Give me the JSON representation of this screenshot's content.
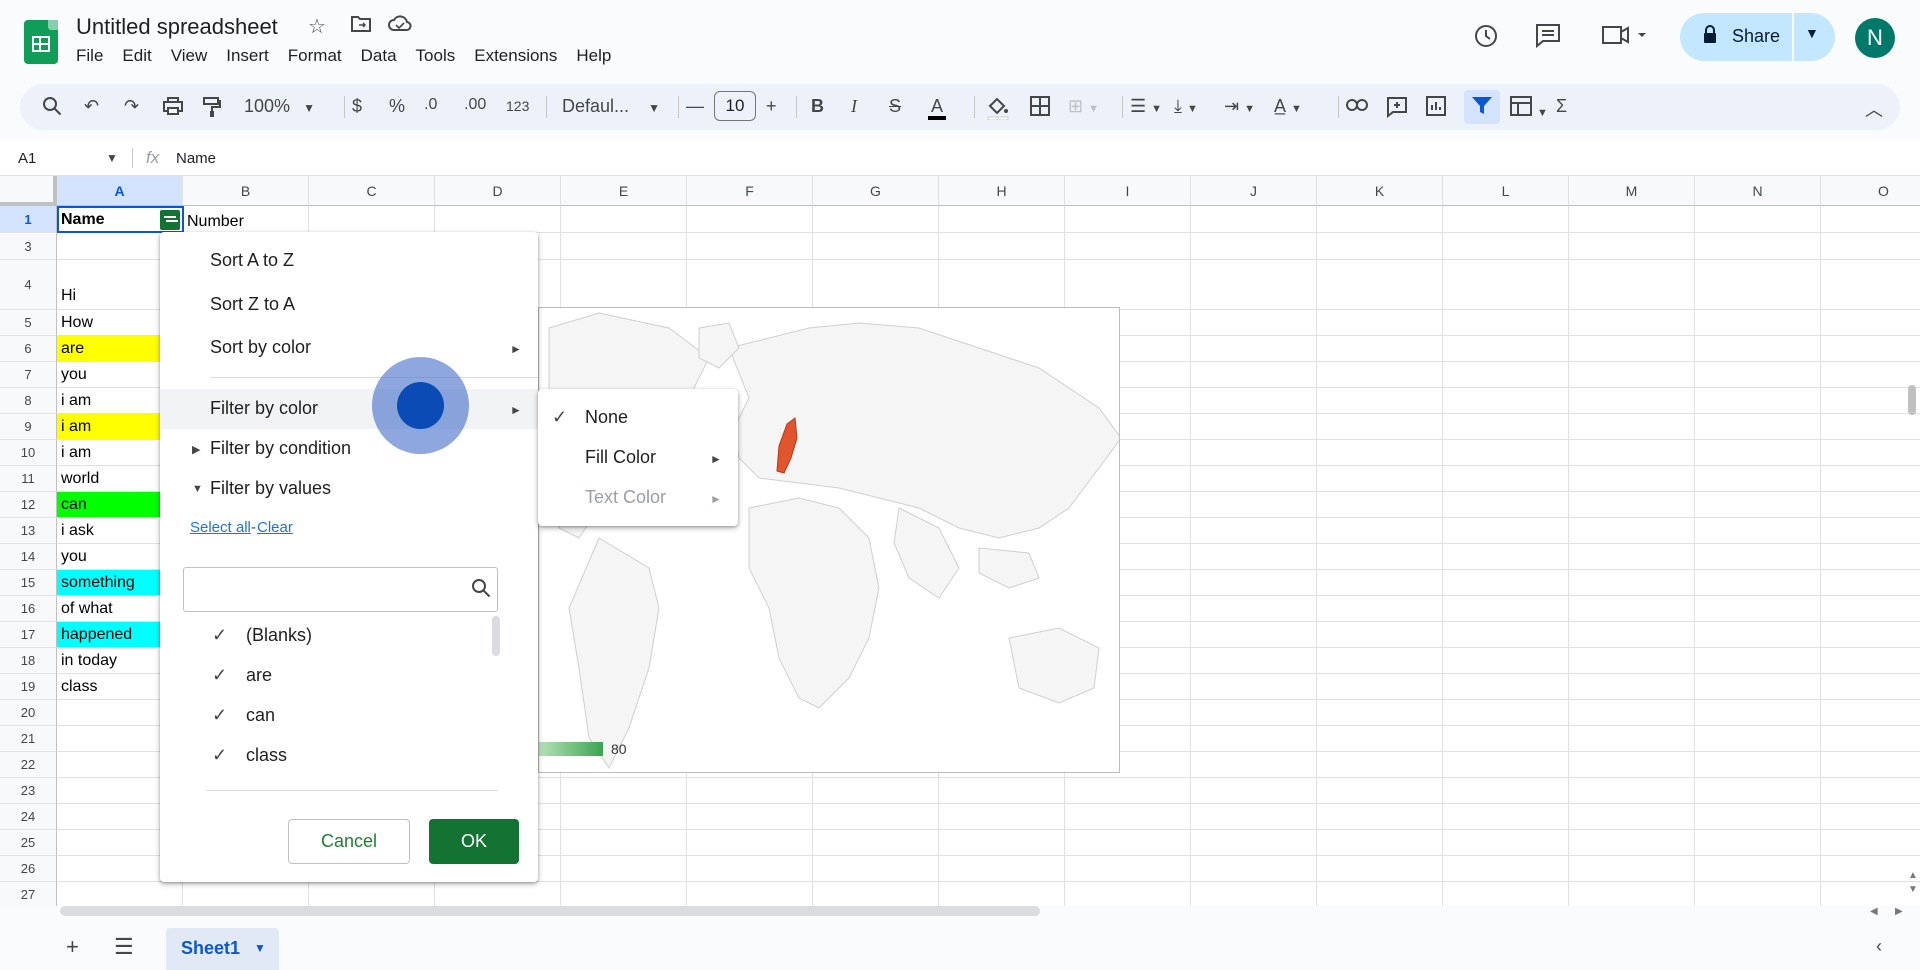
{
  "header": {
    "doc_title": "Untitled spreadsheet",
    "menu": [
      "File",
      "Edit",
      "View",
      "Insert",
      "Format",
      "Data",
      "Tools",
      "Extensions",
      "Help"
    ],
    "share_label": "Share",
    "avatar_initial": "N"
  },
  "toolbar": {
    "zoom": "100%",
    "currency": "$",
    "percent": "%",
    "dec_decrease": ".0",
    "dec_increase": ".00",
    "number_format": "123",
    "font": "Defaul...",
    "font_size": "10"
  },
  "formula_bar": {
    "cell_ref": "A1",
    "fx": "fx",
    "value": "Name"
  },
  "grid": {
    "columns": [
      "A",
      "B",
      "C",
      "D",
      "E",
      "F",
      "G",
      "H",
      "I",
      "J",
      "K",
      "L",
      "M",
      "N",
      "O"
    ],
    "rows": [
      "1",
      "3",
      "4",
      "5",
      "6",
      "7",
      "8",
      "9",
      "10",
      "11",
      "12",
      "13",
      "14",
      "15",
      "16",
      "17",
      "18",
      "19",
      "20",
      "21",
      "22",
      "23",
      "24",
      "25",
      "26",
      "27"
    ],
    "cells_a": [
      "Name",
      "",
      "Hi",
      "How",
      "are",
      "you",
      "i am",
      "i am",
      "i am",
      "world",
      "can",
      "i ask",
      "you",
      "something",
      "of what",
      "happened",
      "in today",
      "class",
      "",
      "",
      "",
      "",
      "",
      "",
      "",
      ""
    ],
    "cell_fill_colors": {
      "yellow": "#ffff00",
      "green": "#00ff00",
      "cyan": "#00ffff"
    },
    "b1": "Number"
  },
  "chart": {
    "legend_max": "80",
    "highlight_color": "#e0552d"
  },
  "filter_menu": {
    "sort_az": "Sort A to Z",
    "sort_za": "Sort Z to A",
    "sort_color": "Sort by color",
    "filter_color": "Filter by color",
    "filter_condition": "Filter by condition",
    "filter_values": "Filter by values",
    "select_all": "Select all",
    "separator": "-",
    "clear": "Clear",
    "values": [
      "(Blanks)",
      "are",
      "can",
      "class"
    ],
    "cancel": "Cancel",
    "ok": "OK"
  },
  "submenu": {
    "none": "None",
    "fill_color": "Fill Color",
    "text_color": "Text Color"
  },
  "bottom": {
    "sheet_name": "Sheet1"
  },
  "icons": {
    "check": "✓",
    "arrow_right": "►"
  }
}
